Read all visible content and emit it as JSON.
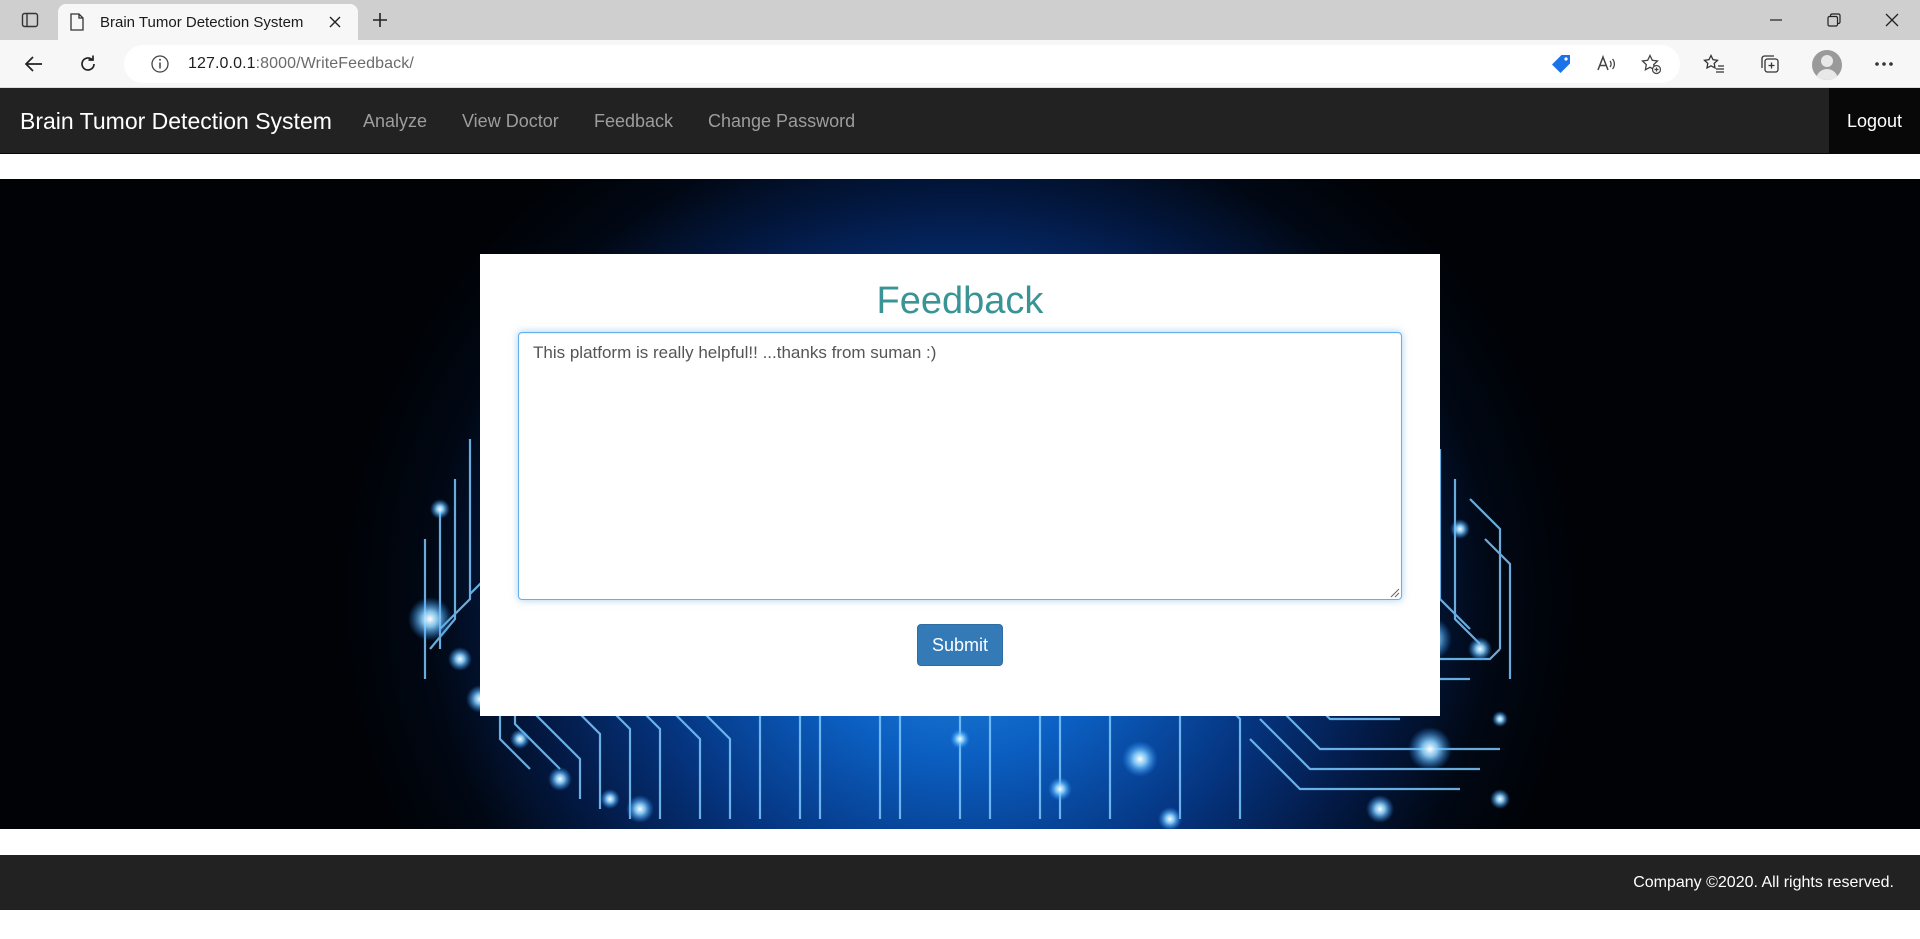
{
  "browser": {
    "tab_title": "Brain Tumor Detection System",
    "url_host": "127.0.0.1",
    "url_path": ":8000/WriteFeedback/"
  },
  "navbar": {
    "brand": "Brain Tumor Detection System",
    "links": [
      "Analyze",
      "View Doctor",
      "Feedback",
      "Change Password"
    ],
    "logout": "Logout"
  },
  "form": {
    "title": "Feedback",
    "feedback_value": "This platform is really helpful!! ...thanks from suman :)",
    "submit_label": "Submit"
  },
  "footer": {
    "text": "Company ©2020. All rights reserved."
  }
}
